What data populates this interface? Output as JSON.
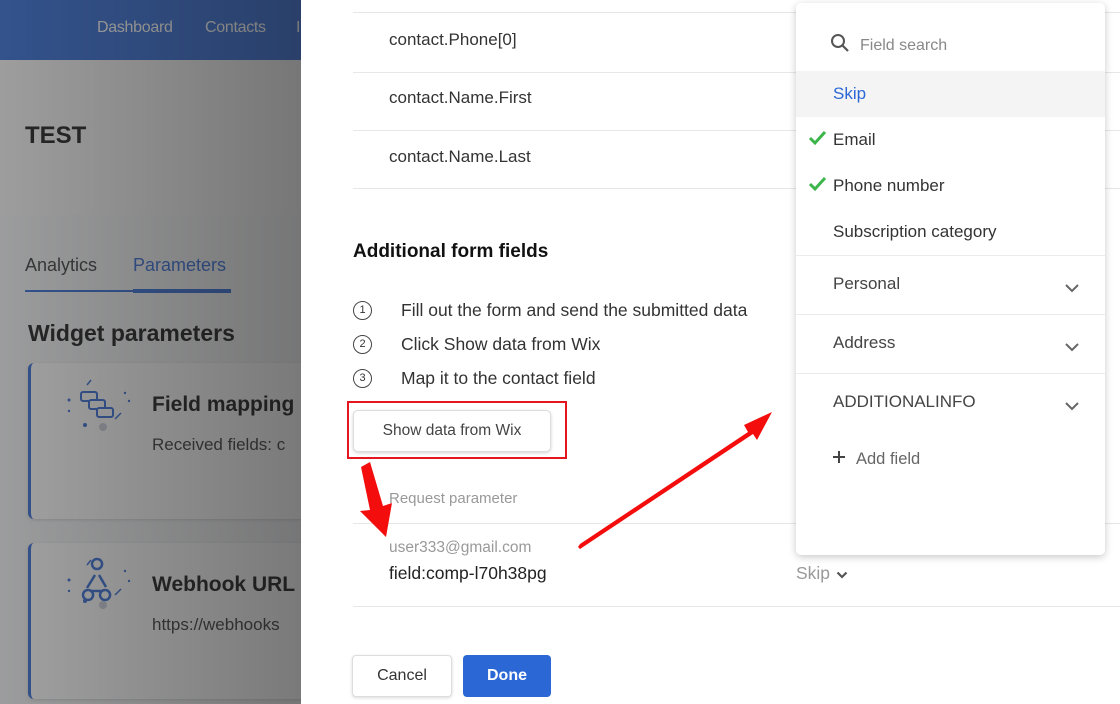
{
  "background": {
    "nav": [
      "Dashboard",
      "Contacts",
      "I"
    ],
    "page_title": "TEST",
    "tabs": [
      {
        "label": "Analytics",
        "active": false
      },
      {
        "label": "Parameters",
        "active": true
      }
    ],
    "section_title": "Widget parameters",
    "cards": [
      {
        "title": "Field mapping",
        "subtitle": "Received fields:  c",
        "icon": "field-mapping-icon"
      },
      {
        "title": "Webhook URL",
        "subtitle": "https://webhooks",
        "icon": "webhook-icon"
      }
    ]
  },
  "panel": {
    "contact_rows": [
      "contact.Phone[0]",
      "contact.Name.First",
      "contact.Name.Last"
    ],
    "additional_title": "Additional form fields",
    "steps": [
      {
        "num": "1",
        "text": "Fill out the form and send the submitted data"
      },
      {
        "num": "2",
        "text": "Click Show data from Wix"
      },
      {
        "num": "3",
        "text": "Map it to the contact field"
      }
    ],
    "show_data_button": "Show data from Wix",
    "request_parameter_label": "Request parameter",
    "request_rows": [
      {
        "sample_value": "user333@gmail.com",
        "field": "field:comp-l70h38pg",
        "mapping": "Skip"
      }
    ],
    "cancel_label": "Cancel",
    "done_label": "Done"
  },
  "dropdown": {
    "search_placeholder": "Field search",
    "items": [
      {
        "label": "Skip",
        "selected": true,
        "checked": false
      },
      {
        "label": "Email",
        "selected": false,
        "checked": true
      },
      {
        "label": "Phone number",
        "selected": false,
        "checked": true
      },
      {
        "label": "Subscription category",
        "selected": false,
        "checked": false
      }
    ],
    "groups": [
      "Personal",
      "Address",
      "ADDITIONALINFO"
    ],
    "add_field_label": "Add field"
  },
  "colors": {
    "accent": "#2c67d6",
    "check": "#3cb54a",
    "annotation": "#e4161f"
  }
}
